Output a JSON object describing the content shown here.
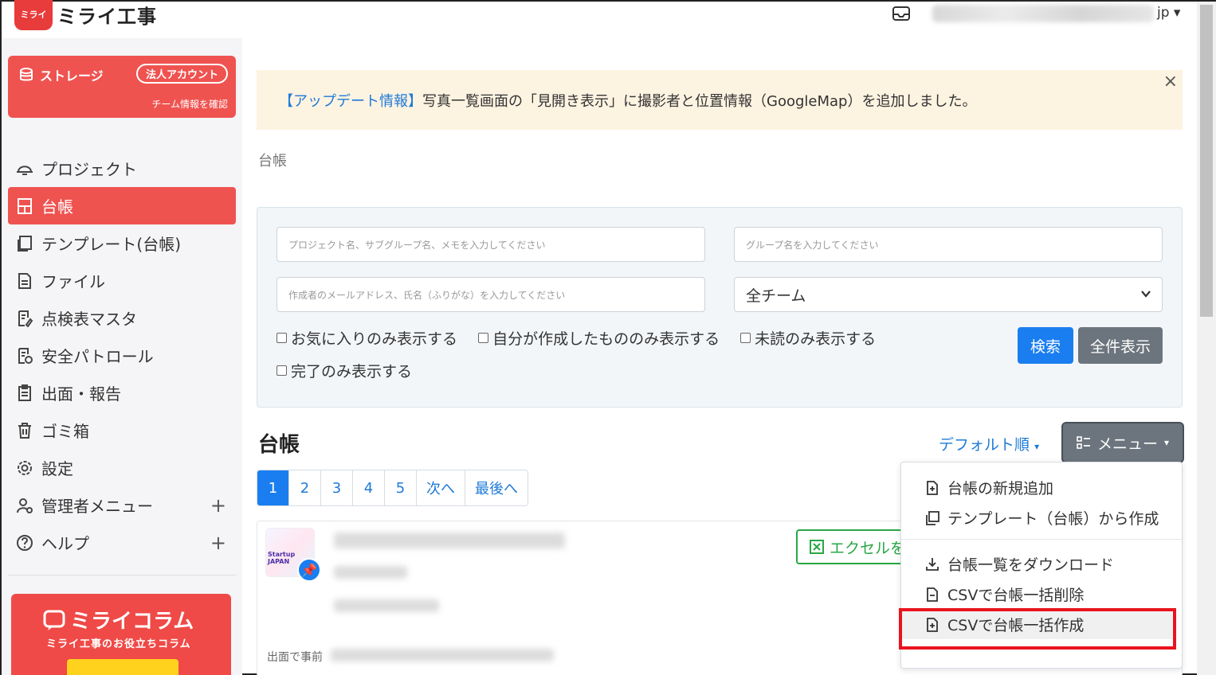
{
  "header": {
    "logo_badge": "ミライ",
    "logo_text": "ミライ工事",
    "user_suffix": "jp"
  },
  "sidebar": {
    "storage": {
      "label": "ストレージ",
      "badge": "法人アカウント",
      "link": "チーム情報を確認"
    },
    "items": [
      {
        "label": "プロジェクト",
        "icon": "project-icon",
        "active": false
      },
      {
        "label": "台帳",
        "icon": "ledger-icon",
        "active": true
      },
      {
        "label": "テンプレート(台帳)",
        "icon": "template-icon",
        "active": false
      },
      {
        "label": "ファイル",
        "icon": "file-icon",
        "active": false
      },
      {
        "label": "点検表マスタ",
        "icon": "checklist-icon",
        "active": false
      },
      {
        "label": "安全パトロール",
        "icon": "patrol-icon",
        "active": false
      },
      {
        "label": "出面・報告",
        "icon": "report-icon",
        "active": false
      },
      {
        "label": "ゴミ箱",
        "icon": "trash-icon",
        "active": false
      },
      {
        "label": "設定",
        "icon": "gear-icon",
        "active": false
      },
      {
        "label": "管理者メニュー",
        "icon": "admin-icon",
        "active": false,
        "expandable": true
      },
      {
        "label": "ヘルプ",
        "icon": "help-icon",
        "active": false,
        "expandable": true
      }
    ],
    "expand_symbol": "+",
    "column": {
      "title": "ミライコラム",
      "subtitle": "ミライ工事のお役立ちコラム"
    }
  },
  "alert": {
    "link": "【アップデート情報】",
    "text": "写真一覧画面の「見開き表示」に撮影者と位置情報（GoogleMap）を追加しました。",
    "close": "×"
  },
  "breadcrumb": "台帳",
  "search": {
    "project_placeholder": "プロジェクト名、サブグループ名、メモを入力してください",
    "group_placeholder": "グループ名を入力してください",
    "author_placeholder": "作成者のメールアドレス、氏名（ふりがな）を入力してください",
    "team_select": "全チーム",
    "checkboxes": [
      "お気に入りのみ表示する",
      "自分が作成したもののみ表示する",
      "未読のみ表示する",
      "完了のみ表示する"
    ],
    "search_button": "検索",
    "show_all_button": "全件表示"
  },
  "list": {
    "title": "台帳",
    "sort": "デフォルト順",
    "menu": "メニュー",
    "pages": [
      "1",
      "2",
      "3",
      "4",
      "5",
      "次へ",
      "最後へ"
    ],
    "card": {
      "thumb_label": "Startup JAPAN",
      "excel_button": "エクセルを",
      "foot": "出面で事前"
    }
  },
  "dropdown": {
    "items": [
      {
        "label": "台帳の新規追加",
        "icon": "file-plus-icon"
      },
      {
        "label": "テンプレート（台帳）から作成",
        "icon": "copy-icon"
      },
      {
        "label": "台帳一覧をダウンロード",
        "icon": "download-icon"
      },
      {
        "label": "CSVで台帳一括削除",
        "icon": "file-minus-icon"
      },
      {
        "label": "CSVで台帳一括作成",
        "icon": "file-plus-icon"
      }
    ]
  },
  "colors": {
    "brand": "#ef5350",
    "primary": "#1a7ef0",
    "secondary": "#6c757d",
    "highlight_frame": "#e8141e"
  }
}
